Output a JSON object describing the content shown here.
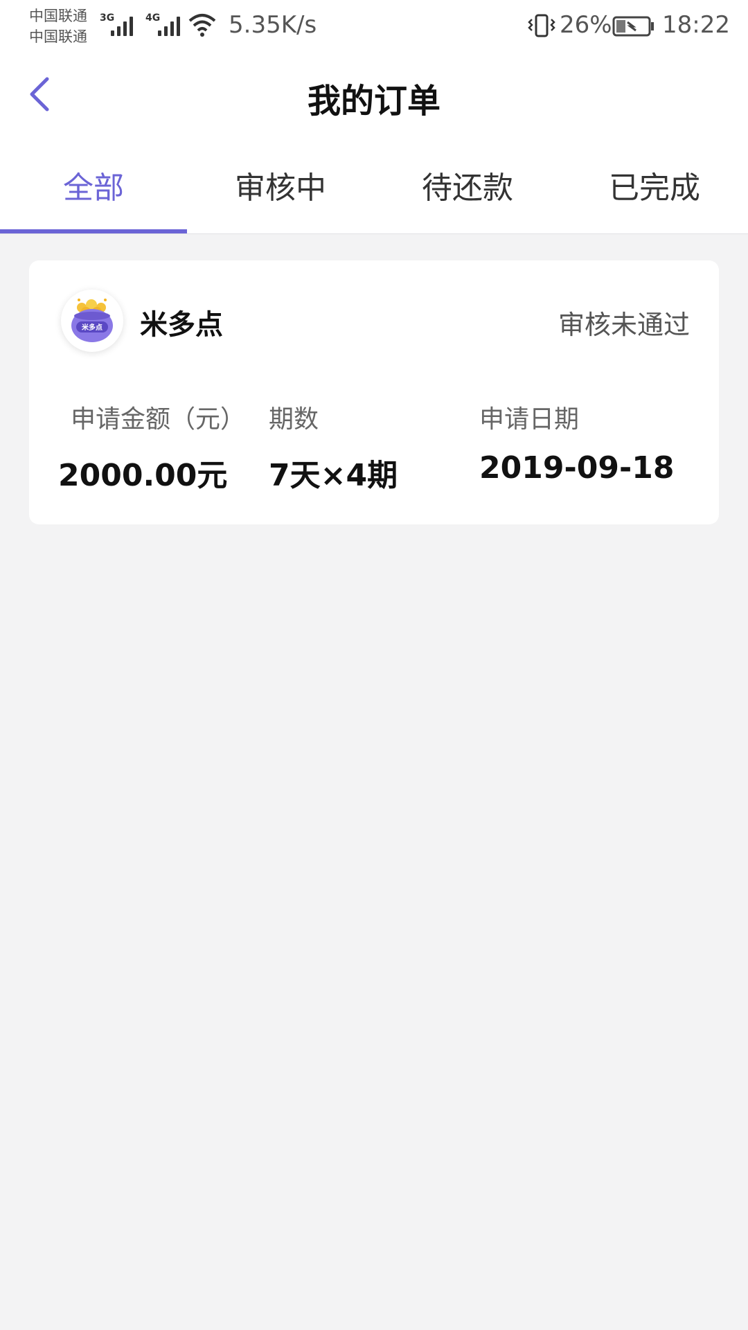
{
  "status_bar": {
    "carrier1": "中国联通",
    "carrier2": "中国联通",
    "net1": "3G",
    "net2": "4G",
    "speed": "5.35K/s",
    "battery_pct": "26%",
    "time": "18:22"
  },
  "header": {
    "title": "我的订单",
    "back_icon": "back-arrow-icon"
  },
  "tabs": [
    {
      "label": "全部",
      "active": true
    },
    {
      "label": "审核中",
      "active": false
    },
    {
      "label": "待还款",
      "active": false
    },
    {
      "label": "已完成",
      "active": false
    }
  ],
  "order": {
    "lender_name": "米多点",
    "logo_text": "米多点",
    "status": "审核未通过",
    "amount_label": "申请金额（元）",
    "amount_value": "2000.00元",
    "period_label": "期数",
    "period_value": "7天×4期",
    "date_label": "申请日期",
    "date_value": "2019-09-18"
  },
  "colors": {
    "accent": "#6b64d6",
    "background": "#f3f3f4"
  }
}
